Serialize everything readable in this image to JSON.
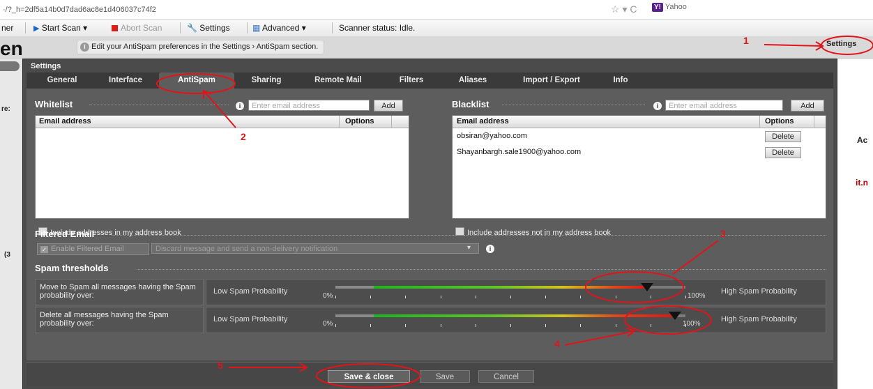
{
  "browser": {
    "url": "·/?_h=2df5a14b0d7dad6ac8e1d406037c74f2",
    "nav_controls": "☆ ▾ C",
    "search_engine": "Yahoo",
    "search_logo": "Y!"
  },
  "toolbar": {
    "left_fragment": "ner",
    "start_scan": "Start Scan ▾",
    "abort_scan": "Abort Scan",
    "settings": "Settings",
    "advanced": "Advanced ▾",
    "scanner_status": "Scanner status: Idle."
  },
  "app": {
    "logo_fragment": "en",
    "info_banner": "Edit your AntiSpam preferences in the Settings › AntiSpam section.",
    "settings_link": "Settings"
  },
  "dialog": {
    "title": "Settings",
    "tabs": [
      "General",
      "Interface",
      "AntiSpam",
      "Sharing",
      "Remote Mail",
      "Filters",
      "Aliases",
      "Import / Export",
      "Info"
    ],
    "active_tab": "AntiSpam"
  },
  "whitelist": {
    "title": "Whitelist",
    "placeholder": "Enter email address",
    "add_label": "Add",
    "col_email": "Email address",
    "col_options": "Options",
    "include_label": "Include addresses in my address book"
  },
  "blacklist": {
    "title": "Blacklist",
    "placeholder": "Enter email address",
    "add_label": "Add",
    "col_email": "Email address",
    "col_options": "Options",
    "rows": [
      {
        "email": "obsiran@yahoo.com",
        "action": "Delete"
      },
      {
        "email": "Shayanbargh.sale1900@yahoo.com",
        "action": "Delete"
      }
    ],
    "include_label": "Include addresses not in my address book"
  },
  "filtered": {
    "title": "Filtered Email",
    "enable_label": "Enable Filtered Email",
    "select_value": "Discard message and send a non-delivery notification"
  },
  "thresholds": {
    "title": "Spam thresholds",
    "low_label": "Low Spam Probability",
    "high_label": "High Spam Probability",
    "min_pct": "0%",
    "max_pct": "100%",
    "move": {
      "label": "Move to Spam all messages having the Spam probability over:",
      "level": 0.89
    },
    "delete": {
      "label": "Delete all messages having the Spam probability over:",
      "level": 0.97
    }
  },
  "footer": {
    "save_close": "Save & close",
    "save": "Save",
    "cancel": "Cancel"
  },
  "annotations": [
    "1",
    "2",
    "3",
    "4",
    "5"
  ],
  "side_text": {
    "left": [
      "re:",
      "(3"
    ],
    "right": [
      "Ac",
      "it.n"
    ]
  },
  "colors": {
    "annotation": "#e0151a",
    "dialog_bg": "#5d5d5d",
    "tab_bar": "#3a3a3a"
  }
}
